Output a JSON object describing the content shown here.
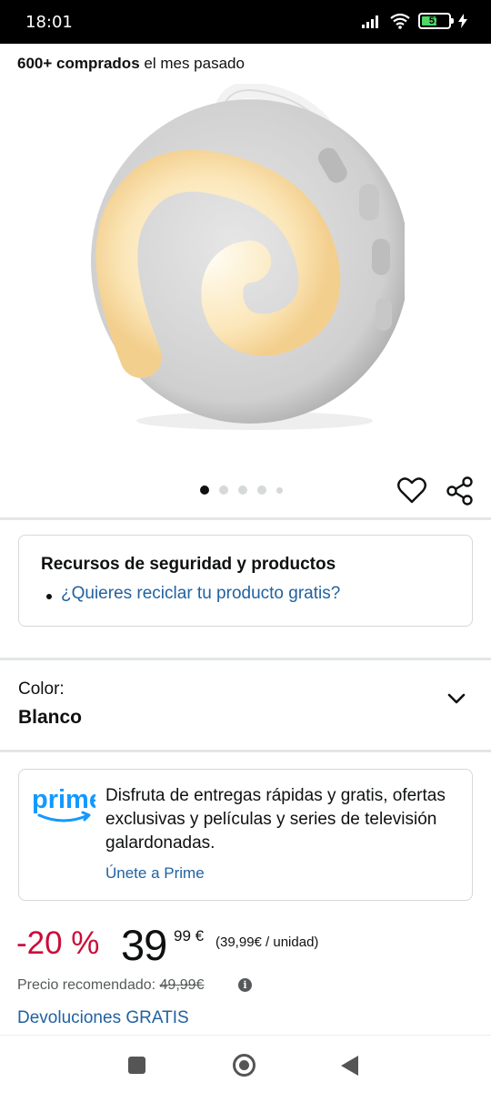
{
  "status_bar": {
    "time": "18:01",
    "battery": "57",
    "battery_level": 0.57,
    "icons": [
      "signal-icon",
      "wifi-icon",
      "battery-icon",
      "charging-icon"
    ]
  },
  "product": {
    "bought_bold": "600+ comprados",
    "bought_rest": " el mes pasado",
    "image_icon": "white-noise-machine-image",
    "carousel_count": 5,
    "carousel_active": 1
  },
  "safety": {
    "title": "Recursos de seguridad y productos",
    "link": "¿Quieres reciclar tu producto gratis?"
  },
  "color": {
    "label": "Color:",
    "value": "Blanco"
  },
  "prime": {
    "logo_text": "prime",
    "description": "Disfruta de entregas rápidas y gratis, ofertas exclusivas y películas y series de televisión galardonadas.",
    "link": "Únete a Prime",
    "brand_color": "#1399ff"
  },
  "price": {
    "discount": "-20 %",
    "whole": "39",
    "cents": "99 €",
    "unit": "(39,99€ / unidad)",
    "recommended_label": "Precio recomendado: ",
    "recommended_value": "49,99€",
    "returns": "Devoluciones GRATIS"
  },
  "colors": {
    "link": "#2162a1",
    "discount": "#cc0c39",
    "text": "#0f1111"
  }
}
